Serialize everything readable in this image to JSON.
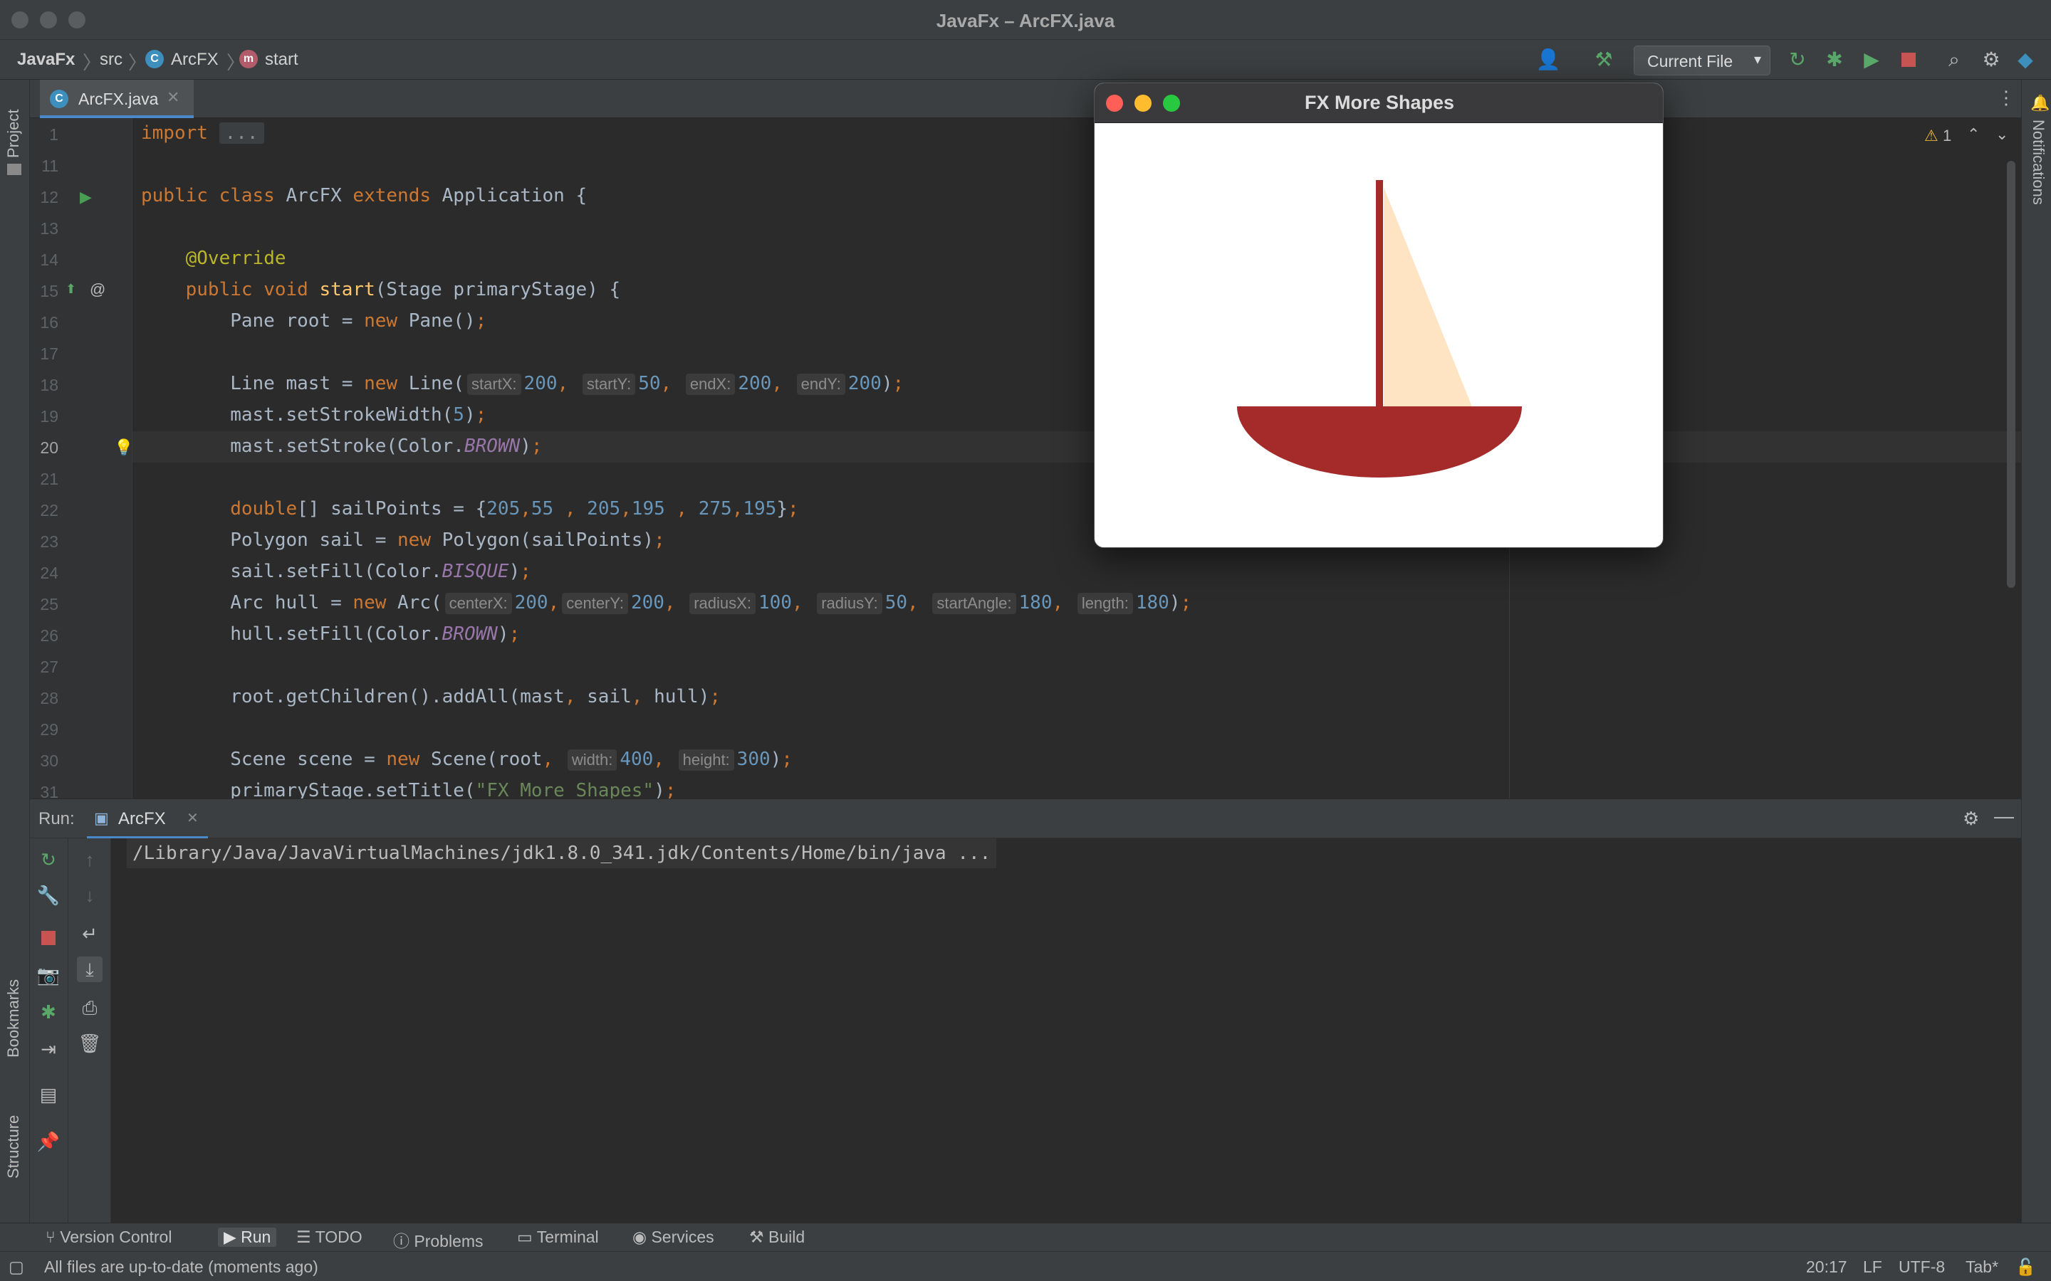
{
  "window": {
    "title": "JavaFx – ArcFX.java"
  },
  "breadcrumb": {
    "project": "JavaFx",
    "folder": "src",
    "class": "ArcFX",
    "method": "start"
  },
  "toolbar": {
    "run_config": "Current File"
  },
  "left_strip": {
    "project_label": "Project",
    "bookmarks_label": "Bookmarks",
    "structure_label": "Structure"
  },
  "right_strip": {
    "notifications_label": "Notifications"
  },
  "editor": {
    "tab_label": "ArcFX.java",
    "warning_count": "1",
    "lines": {
      "l1": "1",
      "l11": "11",
      "l12": "12",
      "l13": "13",
      "l14": "14",
      "l15": "15",
      "l16": "16",
      "l17": "17",
      "l18": "18",
      "l19": "19",
      "l20": "20",
      "l21": "21",
      "l22": "22",
      "l23": "23",
      "l24": "24",
      "l25": "25",
      "l26": "26",
      "l27": "27",
      "l28": "28",
      "l29": "29",
      "l30": "30",
      "l31": "31"
    },
    "hints": {
      "startX": "startX:",
      "startY": "startY:",
      "endX": "endX:",
      "endY": "endY:",
      "centerX": "centerX:",
      "centerY": "centerY:",
      "radiusX": "radiusX:",
      "radiusY": "radiusY:",
      "startAngle": "startAngle:",
      "length": "length:",
      "width": "width:",
      "height": "height:"
    }
  },
  "run_panel": {
    "label": "Run:",
    "tab_label": "ArcFX",
    "console_output": "/Library/Java/JavaVirtualMachines/jdk1.8.0_341.jdk/Contents/Home/bin/java ..."
  },
  "bottom_tools": {
    "version_control": "Version Control",
    "run": "Run",
    "todo": "TODO",
    "problems": "Problems",
    "terminal": "Terminal",
    "services": "Services",
    "build": "Build"
  },
  "status_bar": {
    "message": "All files are up-to-date (moments ago)",
    "position": "20:17",
    "line_sep": "LF",
    "encoding": "UTF-8",
    "indent": "Tab*"
  },
  "fx_window": {
    "title": "FX More Shapes",
    "colors": {
      "mast": "#a52a2a",
      "sail": "#ffe4c4",
      "hull": "#a52a2a",
      "background": "#ffffff"
    }
  },
  "colors": {
    "accent": "#4a88c7",
    "editor_bg": "#2b2b2b",
    "panel_bg": "#3c3f41"
  }
}
